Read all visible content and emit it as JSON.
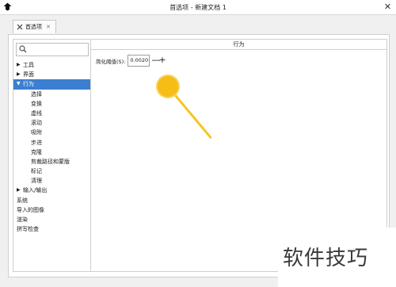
{
  "window": {
    "title": "首选项 - 新建文档 1",
    "close_glyph": "✕"
  },
  "tab": {
    "label": "首选项",
    "close_glyph": "✕"
  },
  "sidebar": {
    "items": [
      {
        "label": "工具",
        "arrow": "▶",
        "level": 0
      },
      {
        "label": "界面",
        "arrow": "▶",
        "level": 0
      },
      {
        "label": "行为",
        "arrow": "▼",
        "level": 0,
        "selected": true
      },
      {
        "label": "选择",
        "level": 1
      },
      {
        "label": "变换",
        "level": 1
      },
      {
        "label": "虚线",
        "level": 1
      },
      {
        "label": "滚动",
        "level": 1
      },
      {
        "label": "吸附",
        "level": 1
      },
      {
        "label": "步进",
        "level": 1
      },
      {
        "label": "克隆",
        "level": 1
      },
      {
        "label": "剪裁路径和蒙版",
        "level": 1
      },
      {
        "label": "标记",
        "level": 1
      },
      {
        "label": "清理",
        "level": 1
      },
      {
        "label": "输入/输出",
        "arrow": "▶",
        "level": 0
      },
      {
        "label": "系统",
        "level": -1
      },
      {
        "label": "导入的图像",
        "level": -1
      },
      {
        "label": "渲染",
        "level": -1
      },
      {
        "label": "拼写检查",
        "level": -1
      }
    ]
  },
  "content": {
    "header": "行为",
    "simplify_label": "简化阈值(S):",
    "simplify_value": "0.0020",
    "minus_glyph": "—",
    "plus_glyph": "+"
  },
  "watermark": "软件技巧",
  "colors": {
    "selection": "#3c7fd1",
    "cursor": "#f6bd16"
  }
}
